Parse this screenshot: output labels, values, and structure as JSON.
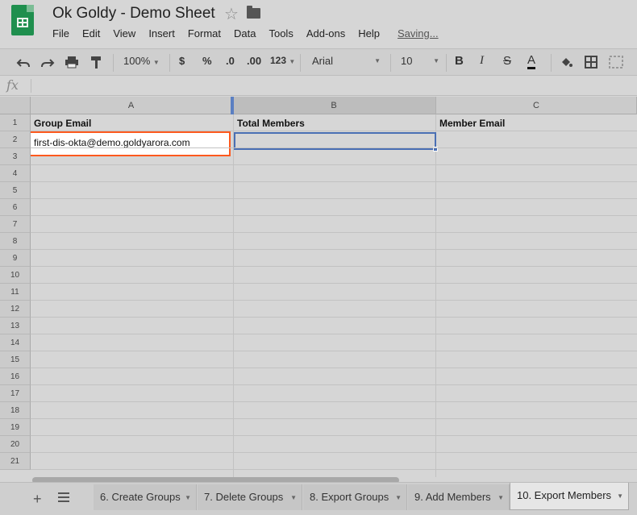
{
  "title": "Ok Goldy - Demo Sheet",
  "status": "Saving...",
  "menu": [
    "File",
    "Edit",
    "View",
    "Insert",
    "Format",
    "Data",
    "Tools",
    "Add-ons",
    "Help"
  ],
  "toolbar": {
    "zoom": "100%",
    "currency": "$",
    "percent": "%",
    "decrease_decimal": ".0",
    "increase_decimal": ".00",
    "more_formats": "123",
    "font": "Arial",
    "font_size": "10",
    "bold": "B",
    "italic": "I",
    "strike": "S",
    "text_color": "A"
  },
  "formula_bar": {
    "fx": "fx",
    "value": ""
  },
  "columns": [
    "A",
    "B",
    "C"
  ],
  "rows": [
    "1",
    "2",
    "3",
    "4",
    "5",
    "6",
    "7",
    "8",
    "9",
    "10",
    "11",
    "12",
    "13",
    "14",
    "15",
    "16",
    "17",
    "18",
    "19",
    "20",
    "21"
  ],
  "cells": {
    "A1": "Group Email",
    "B1": "Total Members",
    "C1": "Member Email",
    "A2": "first-dis-okta@demo.goldyarora.com"
  },
  "tabs": [
    "6. Create Groups",
    "7. Delete Groups",
    "8. Export Groups",
    "9. Add Members",
    "10. Export Members"
  ],
  "active_tab": "10. Export Members",
  "colors": {
    "highlight": "#ff5a1f",
    "selection": "#4a6fb3",
    "sheets_green": "#1f8f4e"
  }
}
